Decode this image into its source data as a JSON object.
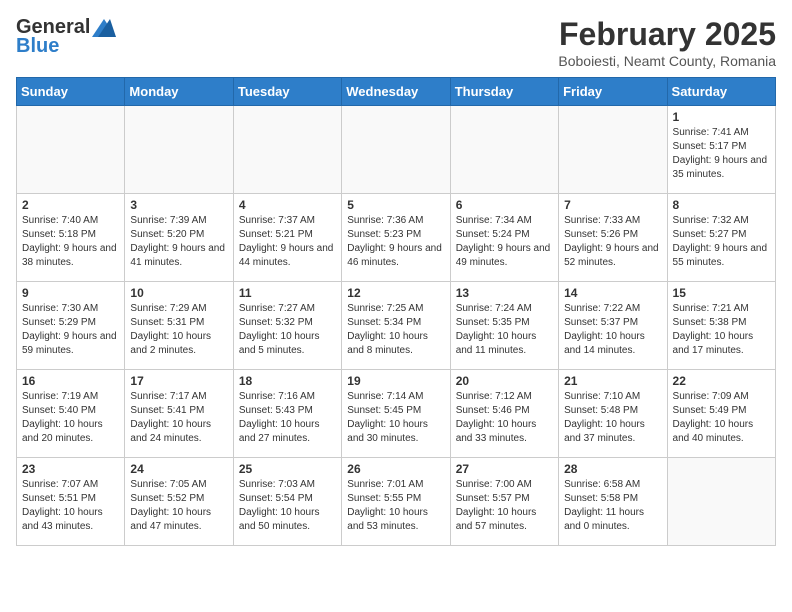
{
  "header": {
    "logo_general": "General",
    "logo_blue": "Blue",
    "month_year": "February 2025",
    "location": "Boboiesti, Neamt County, Romania"
  },
  "calendar": {
    "days_of_week": [
      "Sunday",
      "Monday",
      "Tuesday",
      "Wednesday",
      "Thursday",
      "Friday",
      "Saturday"
    ],
    "weeks": [
      [
        {
          "day": "",
          "info": ""
        },
        {
          "day": "",
          "info": ""
        },
        {
          "day": "",
          "info": ""
        },
        {
          "day": "",
          "info": ""
        },
        {
          "day": "",
          "info": ""
        },
        {
          "day": "",
          "info": ""
        },
        {
          "day": "1",
          "info": "Sunrise: 7:41 AM\nSunset: 5:17 PM\nDaylight: 9 hours and 35 minutes."
        }
      ],
      [
        {
          "day": "2",
          "info": "Sunrise: 7:40 AM\nSunset: 5:18 PM\nDaylight: 9 hours and 38 minutes."
        },
        {
          "day": "3",
          "info": "Sunrise: 7:39 AM\nSunset: 5:20 PM\nDaylight: 9 hours and 41 minutes."
        },
        {
          "day": "4",
          "info": "Sunrise: 7:37 AM\nSunset: 5:21 PM\nDaylight: 9 hours and 44 minutes."
        },
        {
          "day": "5",
          "info": "Sunrise: 7:36 AM\nSunset: 5:23 PM\nDaylight: 9 hours and 46 minutes."
        },
        {
          "day": "6",
          "info": "Sunrise: 7:34 AM\nSunset: 5:24 PM\nDaylight: 9 hours and 49 minutes."
        },
        {
          "day": "7",
          "info": "Sunrise: 7:33 AM\nSunset: 5:26 PM\nDaylight: 9 hours and 52 minutes."
        },
        {
          "day": "8",
          "info": "Sunrise: 7:32 AM\nSunset: 5:27 PM\nDaylight: 9 hours and 55 minutes."
        }
      ],
      [
        {
          "day": "9",
          "info": "Sunrise: 7:30 AM\nSunset: 5:29 PM\nDaylight: 9 hours and 59 minutes."
        },
        {
          "day": "10",
          "info": "Sunrise: 7:29 AM\nSunset: 5:31 PM\nDaylight: 10 hours and 2 minutes."
        },
        {
          "day": "11",
          "info": "Sunrise: 7:27 AM\nSunset: 5:32 PM\nDaylight: 10 hours and 5 minutes."
        },
        {
          "day": "12",
          "info": "Sunrise: 7:25 AM\nSunset: 5:34 PM\nDaylight: 10 hours and 8 minutes."
        },
        {
          "day": "13",
          "info": "Sunrise: 7:24 AM\nSunset: 5:35 PM\nDaylight: 10 hours and 11 minutes."
        },
        {
          "day": "14",
          "info": "Sunrise: 7:22 AM\nSunset: 5:37 PM\nDaylight: 10 hours and 14 minutes."
        },
        {
          "day": "15",
          "info": "Sunrise: 7:21 AM\nSunset: 5:38 PM\nDaylight: 10 hours and 17 minutes."
        }
      ],
      [
        {
          "day": "16",
          "info": "Sunrise: 7:19 AM\nSunset: 5:40 PM\nDaylight: 10 hours and 20 minutes."
        },
        {
          "day": "17",
          "info": "Sunrise: 7:17 AM\nSunset: 5:41 PM\nDaylight: 10 hours and 24 minutes."
        },
        {
          "day": "18",
          "info": "Sunrise: 7:16 AM\nSunset: 5:43 PM\nDaylight: 10 hours and 27 minutes."
        },
        {
          "day": "19",
          "info": "Sunrise: 7:14 AM\nSunset: 5:45 PM\nDaylight: 10 hours and 30 minutes."
        },
        {
          "day": "20",
          "info": "Sunrise: 7:12 AM\nSunset: 5:46 PM\nDaylight: 10 hours and 33 minutes."
        },
        {
          "day": "21",
          "info": "Sunrise: 7:10 AM\nSunset: 5:48 PM\nDaylight: 10 hours and 37 minutes."
        },
        {
          "day": "22",
          "info": "Sunrise: 7:09 AM\nSunset: 5:49 PM\nDaylight: 10 hours and 40 minutes."
        }
      ],
      [
        {
          "day": "23",
          "info": "Sunrise: 7:07 AM\nSunset: 5:51 PM\nDaylight: 10 hours and 43 minutes."
        },
        {
          "day": "24",
          "info": "Sunrise: 7:05 AM\nSunset: 5:52 PM\nDaylight: 10 hours and 47 minutes."
        },
        {
          "day": "25",
          "info": "Sunrise: 7:03 AM\nSunset: 5:54 PM\nDaylight: 10 hours and 50 minutes."
        },
        {
          "day": "26",
          "info": "Sunrise: 7:01 AM\nSunset: 5:55 PM\nDaylight: 10 hours and 53 minutes."
        },
        {
          "day": "27",
          "info": "Sunrise: 7:00 AM\nSunset: 5:57 PM\nDaylight: 10 hours and 57 minutes."
        },
        {
          "day": "28",
          "info": "Sunrise: 6:58 AM\nSunset: 5:58 PM\nDaylight: 11 hours and 0 minutes."
        },
        {
          "day": "",
          "info": ""
        }
      ]
    ]
  }
}
